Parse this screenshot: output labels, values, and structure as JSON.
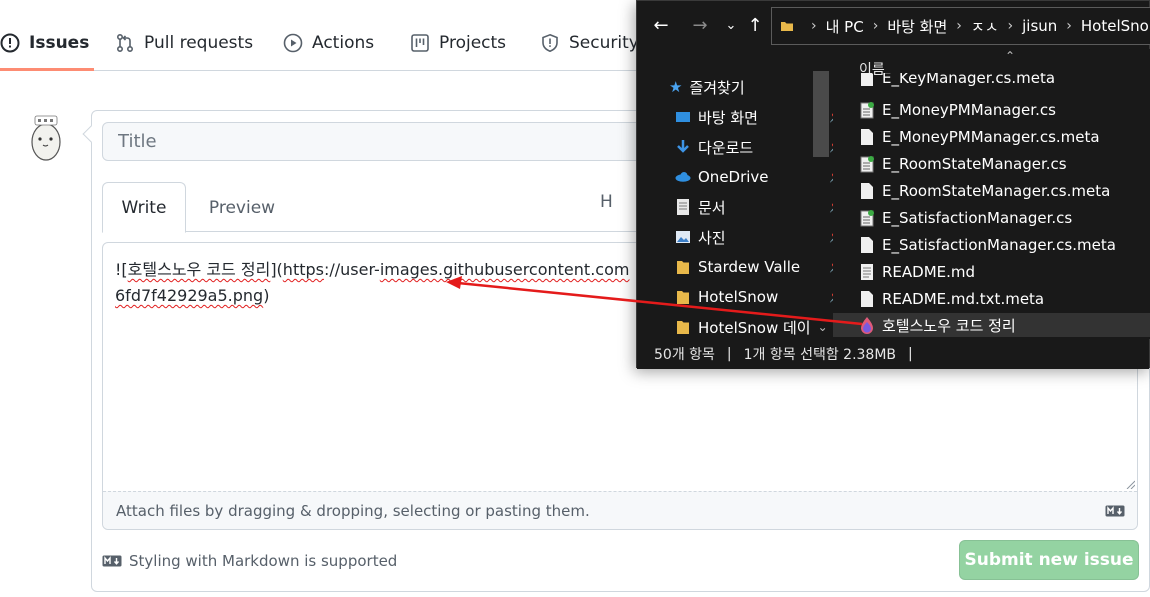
{
  "github": {
    "tabs": [
      {
        "label": "Issues",
        "icon": "issue-opened-icon",
        "active": true
      },
      {
        "label": "Pull requests",
        "icon": "git-pull-request-icon"
      },
      {
        "label": "Actions",
        "icon": "play-icon"
      },
      {
        "label": "Projects",
        "icon": "project-icon"
      },
      {
        "label": "Security",
        "icon": "shield-icon"
      }
    ],
    "title_placeholder": "Title",
    "editor_tabs": {
      "write": "Write",
      "preview": "Preview"
    },
    "toolbar_heading": "H",
    "body_text": {
      "prefix": "![",
      "alt": "호텔스노우 코드 정리",
      "mid": "](",
      "url_a": "https",
      "url_b": "://user-",
      "url_c": "images.githubusercontent.com",
      "line2": "6fd7f42929a5.png",
      "suffix": ")"
    },
    "attach_hint": "Attach files by dragging & dropping, selecting or pasting them.",
    "markdown_note": "Styling with Markdown is supported",
    "submit_label": "Submit new issue",
    "colors": {
      "accent_underline": "#fd8c73",
      "submit_disabled": "#94d3a2"
    }
  },
  "explorer": {
    "breadcrumb": [
      "내 PC",
      "바탕 화면",
      "ㅈㅅ",
      "jisun",
      "HotelSno"
    ],
    "sidebar": [
      {
        "label": "즐겨찾기",
        "icon": "star-icon",
        "pinned": false
      },
      {
        "label": "바탕 화면",
        "icon": "desktop-icon",
        "pinned": true
      },
      {
        "label": "다운로드",
        "icon": "download-icon",
        "pinned": true
      },
      {
        "label": "OneDrive",
        "icon": "cloud-icon",
        "pinned": true
      },
      {
        "label": "문서",
        "icon": "document-icon",
        "pinned": true
      },
      {
        "label": "사진",
        "icon": "picture-icon",
        "pinned": true
      },
      {
        "label": "Stardew Valle",
        "icon": "folder-icon",
        "pinned": true
      },
      {
        "label": "HotelSnow",
        "icon": "folder-icon",
        "pinned": true
      },
      {
        "label": "HotelSnow 데이",
        "icon": "folder-icon",
        "pinned": false
      }
    ],
    "column_header": "이름",
    "files": [
      {
        "name": "E_KeyManager.cs.meta",
        "icon": "file-icon"
      },
      {
        "name": "E_MoneyPMManager.cs",
        "icon": "cs-file-icon"
      },
      {
        "name": "E_MoneyPMManager.cs.meta",
        "icon": "file-icon"
      },
      {
        "name": "E_RoomStateManager.cs",
        "icon": "cs-file-icon"
      },
      {
        "name": "E_RoomStateManager.cs.meta",
        "icon": "file-icon"
      },
      {
        "name": "E_SatisfactionManager.cs",
        "icon": "cs-file-icon"
      },
      {
        "name": "E_SatisfactionManager.cs.meta",
        "icon": "file-icon"
      },
      {
        "name": "README.md",
        "icon": "md-file-icon"
      },
      {
        "name": "README.md.txt.meta",
        "icon": "file-icon"
      },
      {
        "name": "호텔스노우 코드 정리",
        "icon": "image-file-icon",
        "selected": true
      }
    ],
    "status": {
      "count": "50개 항목",
      "selection": "1개 항목 선택함 2.38MB"
    }
  }
}
